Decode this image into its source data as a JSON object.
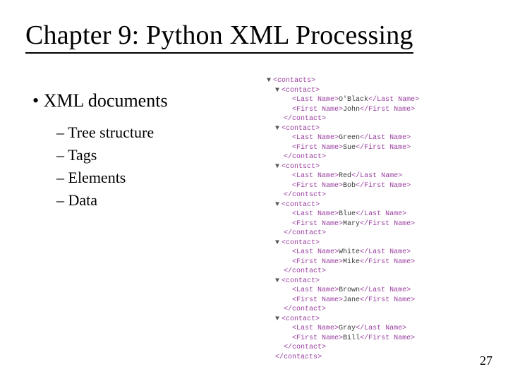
{
  "title": "Chapter 9: Python XML Processing",
  "bullet": "XML documents",
  "subs": [
    "Tree structure",
    "Tags",
    "Elements",
    "Data"
  ],
  "xml": {
    "root": "contacts",
    "child": "contact",
    "lastLabel": "Last Name",
    "firstLabel": "First Name",
    "altChild": "contsct",
    "records": [
      {
        "last": "O'Black",
        "first": "John",
        "tag": "contact"
      },
      {
        "last": "Green",
        "first": "Sue",
        "tag": "contact"
      },
      {
        "last": "Red",
        "first": "Bob",
        "tag": "contsct"
      },
      {
        "last": "Blue",
        "first": "Mary",
        "tag": "contact"
      },
      {
        "last": "White",
        "first": "Mike",
        "tag": "contact"
      },
      {
        "last": "Brown",
        "first": "Jane",
        "tag": "contact"
      },
      {
        "last": "Gray",
        "first": "Bill",
        "tag": "contact"
      }
    ]
  },
  "pageNumber": "27"
}
